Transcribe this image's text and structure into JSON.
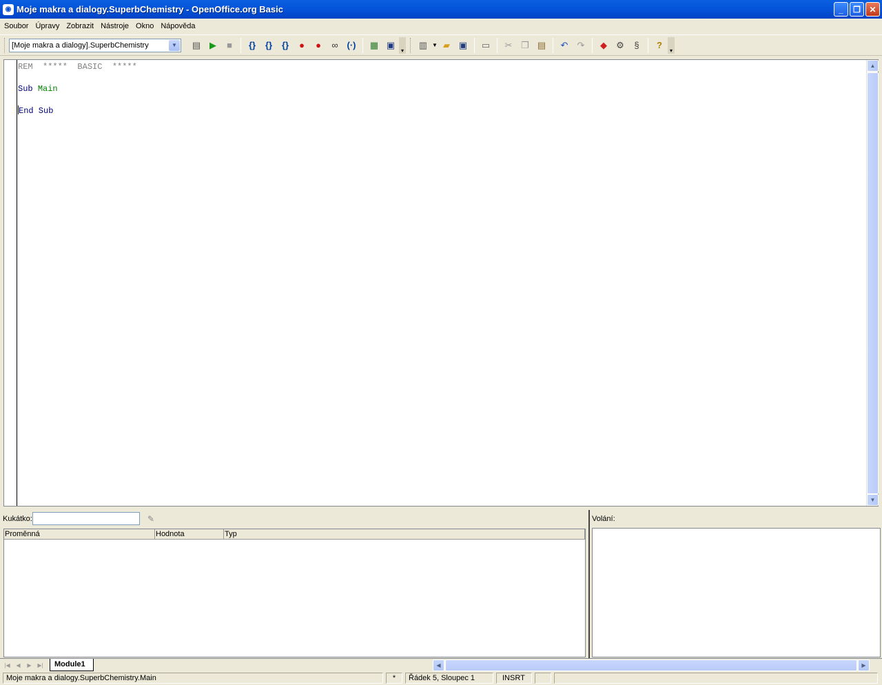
{
  "window": {
    "title": "Moje makra a dialogy.SuperbChemistry - OpenOffice.org Basic",
    "minimize": "_",
    "restore": "❐",
    "close": "✕"
  },
  "menu": [
    "Soubor",
    "Úpravy",
    "Zobrazit",
    "Nástroje",
    "Okno",
    "Nápověda"
  ],
  "toolbar": {
    "library_select": "[Moje makra a dialogy].SuperbChemistry"
  },
  "editor": {
    "lines": [
      {
        "parts": [
          {
            "t": "REM  *****  BASIC  *****",
            "c": "rem"
          }
        ]
      },
      {
        "parts": []
      },
      {
        "parts": [
          {
            "t": "Sub ",
            "c": "kw"
          },
          {
            "t": "Main",
            "c": "id"
          }
        ]
      },
      {
        "parts": []
      },
      {
        "parts": [
          {
            "t": "End Sub",
            "c": "kw"
          }
        ]
      }
    ]
  },
  "watch": {
    "label": "Kukátko:",
    "input_value": "",
    "columns": [
      "Proměnná",
      "Hodnota",
      "Typ"
    ]
  },
  "calls": {
    "label": "Volání:"
  },
  "tabs": {
    "active": "Module1"
  },
  "status": {
    "location": "Moje makra a dialogy.SuperbChemistry.Main",
    "modified": "*",
    "position": "Řádek 5, Sloupec 1",
    "mode": "INSRT"
  }
}
